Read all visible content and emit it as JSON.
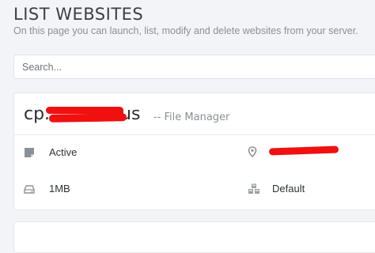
{
  "page": {
    "title": "LIST WEBSITES",
    "description": "On this page you can launch, list, modify and delete websites from your server."
  },
  "search": {
    "placeholder": "Search..."
  },
  "website": {
    "domain_prefix": "cp.",
    "domain_suffix": ".us",
    "file_manager_label": "-- File Manager",
    "status": "Active",
    "disk_usage": "1MB",
    "package": "Default",
    "icons": {
      "status": "note-icon",
      "ip": "location-pin-icon",
      "disk": "hard-drive-icon",
      "package": "cubes-icon"
    }
  },
  "colors": {
    "background": "#f2f4f7",
    "card": "#ffffff",
    "redaction": "#f01010",
    "muted_text": "#8a9099"
  }
}
